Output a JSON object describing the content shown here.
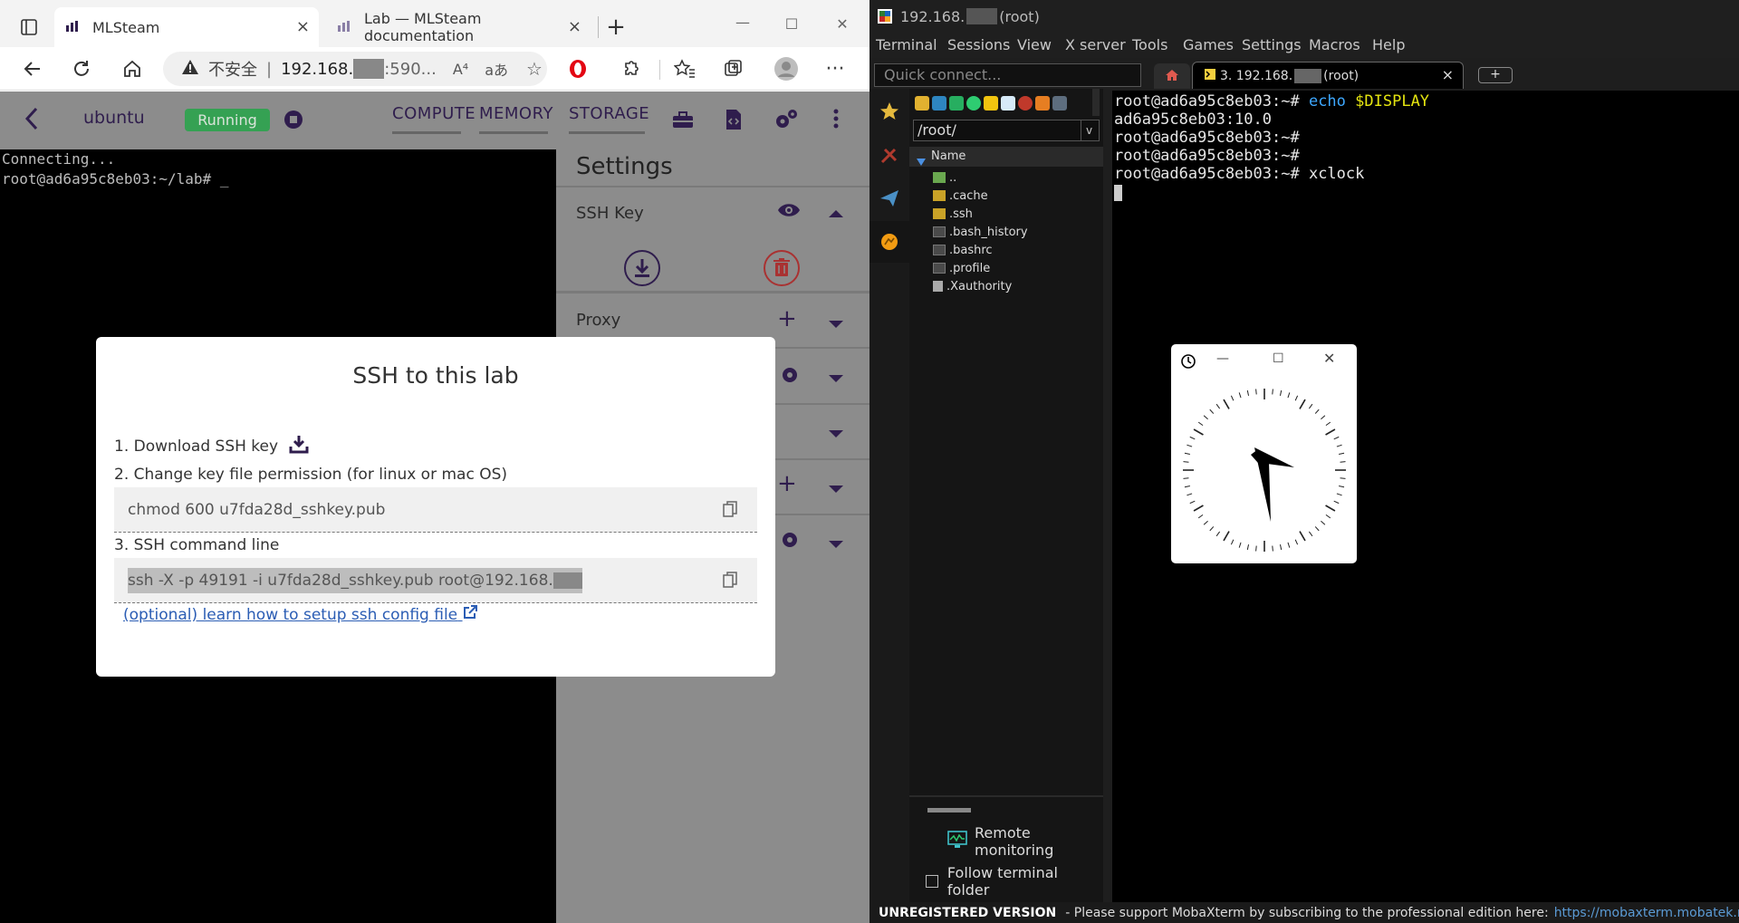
{
  "browser": {
    "tabs": [
      {
        "title": "MLSteam",
        "close": "×"
      },
      {
        "title": "Lab — MLSteam documentation",
        "close": "×"
      }
    ],
    "new_tab": "+",
    "window_controls": {
      "minimize": "—",
      "maximize": "☐",
      "close": "✕"
    },
    "address": {
      "security_label": "不安全",
      "separator": "|",
      "url_prefix": "192.168.",
      "url_suffix": ":590...",
      "read_aloud": "A⁴",
      "translate": "aあ"
    }
  },
  "app": {
    "header": {
      "project_name": "ubuntu",
      "status": "Running",
      "tabs": [
        "COMPUTE",
        "MEMORY",
        "STORAGE"
      ]
    },
    "terminal": {
      "lines": [
        "Connecting...",
        "root@ad6a95c8eb03:~/lab# _"
      ]
    },
    "settings": {
      "title": "Settings",
      "ssh_key_label": "SSH Key",
      "proxy_label": "Proxy"
    },
    "modal": {
      "title": "SSH to this lab",
      "step1": "1. Download SSH key",
      "step2": "2. Change key file permission (for linux or mac OS)",
      "chmod_command": "chmod 600 u7fda28d_sshkey.pub",
      "step3": "3. SSH command line",
      "ssh_command": "ssh -X -p 49191 -i u7fda28d_sshkey.pub root@192.168.",
      "config_link": "(optional) learn how to setup ssh config file"
    }
  },
  "moba": {
    "title_prefix": "192.168.",
    "title_suffix": "(root)",
    "menu": [
      "Terminal",
      "Sessions",
      "View",
      "X server",
      "Tools",
      "Games",
      "Settings",
      "Macros",
      "Help"
    ],
    "quick_connect_placeholder": "Quick connect...",
    "session_tab": {
      "prefix": "3. 192.168.",
      "suffix": "(root)",
      "close": "×"
    },
    "path": "/root/",
    "file_header": "Name",
    "files": [
      "..",
      ".cache",
      ".ssh",
      ".bash_history",
      ".bashrc",
      ".profile",
      ".Xauthority"
    ],
    "terminal": {
      "line1_prompt": "root@ad6a95c8eb03:~#",
      "line1_cmd": "echo",
      "line1_var": "$DISPLAY",
      "line2": "ad6a95c8eb03:10.0",
      "line3": "root@ad6a95c8eb03:~#",
      "line4": "root@ad6a95c8eb03:~#",
      "line5_prompt": "root@ad6a95c8eb03:~#",
      "line5_cmd": "xclock"
    },
    "remote_monitoring": "Remote monitoring",
    "follow_terminal_folder": "Follow terminal folder",
    "status": {
      "unregistered": "UNREGISTERED VERSION",
      "support_text": "-  Please support MobaXterm by subscribing to the professional edition here:",
      "url": "https://mobaxterm.mobatek.net"
    },
    "colors": {
      "accent": "#2f1d4d",
      "running": "#27a54a",
      "link": "#2b5db4",
      "moba_url": "#5b9bd5",
      "var_yellow": "#e5e510",
      "cmd_blue": "#3ea8ff"
    }
  }
}
